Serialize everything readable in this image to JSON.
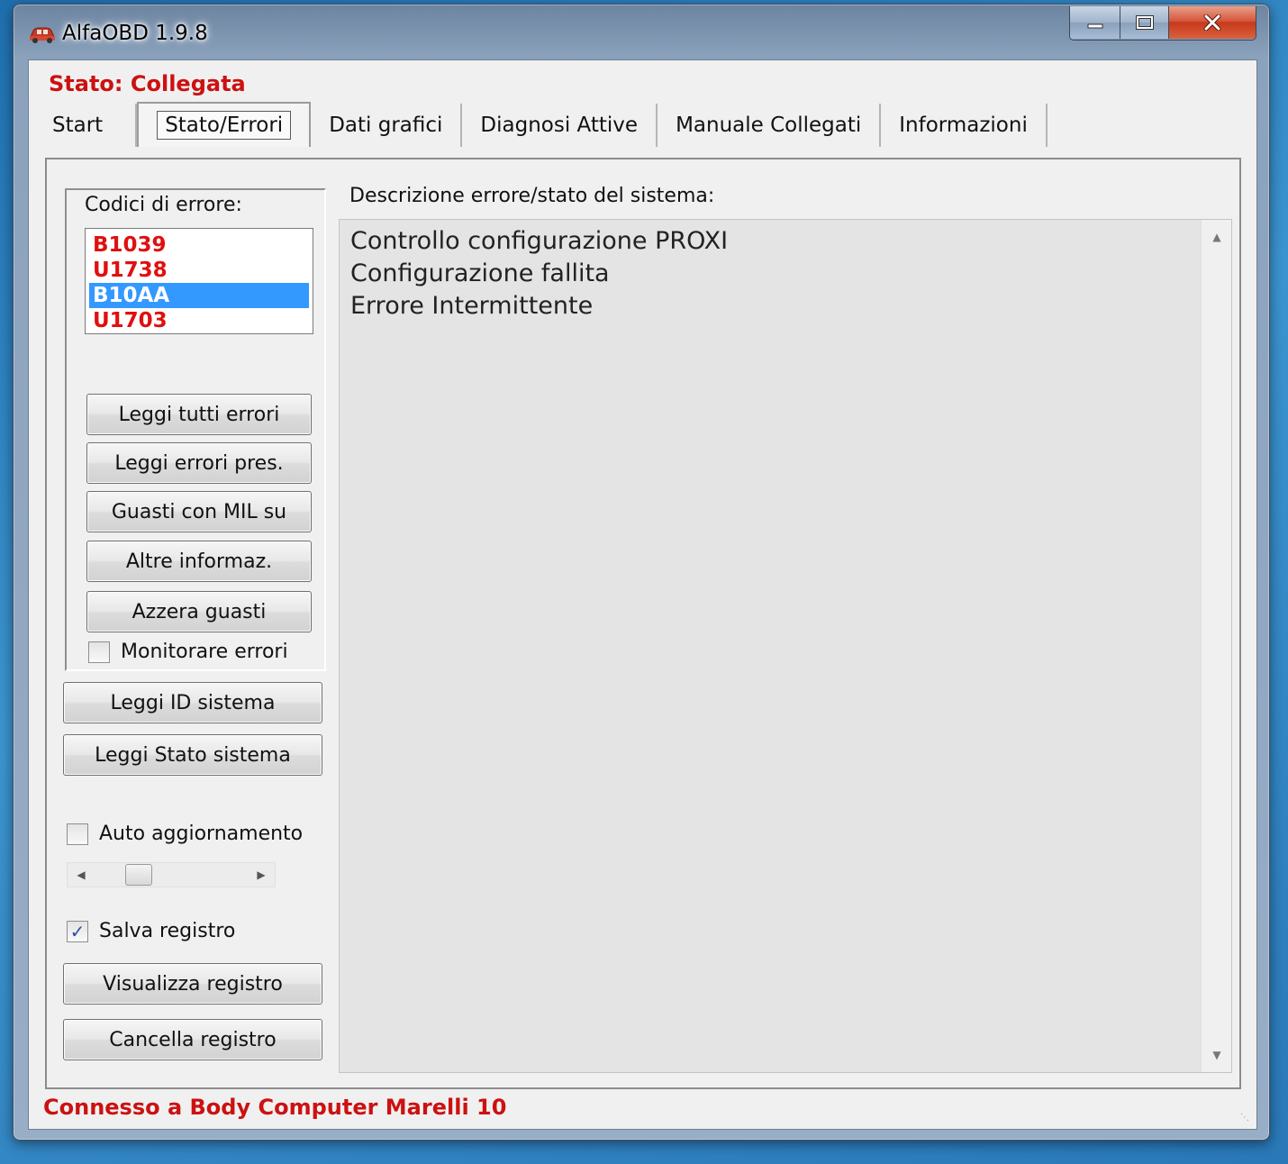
{
  "window": {
    "title": "AlfaOBD 1.9.8",
    "icon": "car-icon",
    "minimize_icon": "minimize-icon",
    "maximize_icon": "maximize-icon",
    "close_icon": "close-icon"
  },
  "status": {
    "top": "Stato: Collegata",
    "bottom": "Connesso a Body Computer Marelli 10",
    "color": "#cc1111"
  },
  "tabs": [
    {
      "label": "Start"
    },
    {
      "label": "Stato/Errori",
      "active": true
    },
    {
      "label": "Dati grafici"
    },
    {
      "label": "Diagnosi Attive"
    },
    {
      "label": "Manuale Collegati"
    },
    {
      "label": "Informazioni"
    }
  ],
  "errors": {
    "label": "Codici di errore:",
    "codes": [
      {
        "code": "B1039",
        "selected": false
      },
      {
        "code": "U1738",
        "selected": false
      },
      {
        "code": "B10AA",
        "selected": true
      },
      {
        "code": "U1703",
        "selected": false
      }
    ],
    "code_color": "#e01010",
    "selected_bg": "#3399ff",
    "buttons": {
      "read_all": "Leggi tutti errori",
      "read_present": "Leggi errori pres.",
      "mil_faults": "Guasti con MIL su",
      "other_info": "Altre informaz.",
      "clear_faults": "Azzera guasti"
    },
    "monitor": {
      "label": "Monitorare errori",
      "checked": false
    }
  },
  "system": {
    "read_id": "Leggi ID sistema",
    "read_status": "Leggi Stato sistema"
  },
  "auto_update": {
    "label": "Auto aggiornamento",
    "checked": false
  },
  "slider": {
    "left_icon": "arrow-left-icon",
    "right_icon": "arrow-right-icon",
    "value": 0.28
  },
  "log": {
    "save": {
      "label": "Salva registro",
      "checked": true
    },
    "view": "Visualizza registro",
    "clear": "Cancella registro"
  },
  "description": {
    "label": "Descrizione errore/stato del sistema:",
    "lines": [
      "Controllo configurazione PROXI",
      "Configurazione fallita",
      "Errore Intermittente"
    ]
  }
}
